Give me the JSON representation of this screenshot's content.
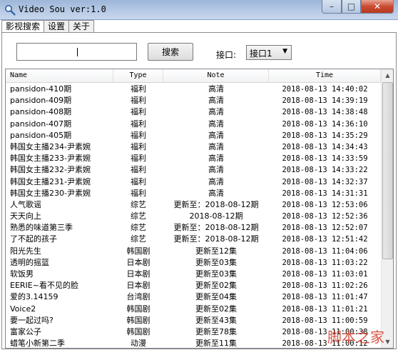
{
  "window": {
    "title": "Video Sou  ver:1.0",
    "minimize_glyph": "–",
    "maximize_glyph": "□",
    "close_glyph": "✕"
  },
  "tabs": [
    "影视搜索",
    "设置",
    "关于"
  ],
  "search": {
    "value": "",
    "button_label": "搜索"
  },
  "port": {
    "label": "接口:",
    "selected": "接口1"
  },
  "columns": {
    "name": "Name",
    "type": "Type",
    "note": "Note",
    "time": "Time"
  },
  "rows": [
    {
      "name": "pansidon-410期",
      "type": "福利",
      "note": "高清",
      "time": "2018-08-13 14:40:02"
    },
    {
      "name": "pansidon-409期",
      "type": "福利",
      "note": "高清",
      "time": "2018-08-13 14:39:19"
    },
    {
      "name": "pansidon-408期",
      "type": "福利",
      "note": "高清",
      "time": "2018-08-13 14:38:48"
    },
    {
      "name": "pansidon-407期",
      "type": "福利",
      "note": "高清",
      "time": "2018-08-13 14:36:10"
    },
    {
      "name": "pansidon-405期",
      "type": "福利",
      "note": "高清",
      "time": "2018-08-13 14:35:29"
    },
    {
      "name": "韩国女主播234-尹素婉",
      "type": "福利",
      "note": "高清",
      "time": "2018-08-13 14:34:43"
    },
    {
      "name": "韩国女主播233-尹素婉",
      "type": "福利",
      "note": "高清",
      "time": "2018-08-13 14:33:59"
    },
    {
      "name": "韩国女主播232-尹素婉",
      "type": "福利",
      "note": "高清",
      "time": "2018-08-13 14:33:22"
    },
    {
      "name": "韩国女主播231-尹素婉",
      "type": "福利",
      "note": "高清",
      "time": "2018-08-13 14:32:37"
    },
    {
      "name": "韩国女主播230-尹素婉",
      "type": "福利",
      "note": "高清",
      "time": "2018-08-13 14:31:31"
    },
    {
      "name": "人气歌谣",
      "type": "综艺",
      "note": "更新至：2018-08-12期",
      "time": "2018-08-13 12:53:06"
    },
    {
      "name": "天天向上",
      "type": "综艺",
      "note": "2018-08-12期",
      "time": "2018-08-13 12:52:36"
    },
    {
      "name": "熟悉的味道第三季",
      "type": "综艺",
      "note": "更新至：2018-08-12期",
      "time": "2018-08-13 12:52:07"
    },
    {
      "name": "了不起的孩子",
      "type": "综艺",
      "note": "更新至：2018-08-12期",
      "time": "2018-08-13 12:51:42"
    },
    {
      "name": "阳光先生",
      "type": "韩国剧",
      "note": "更新至12集",
      "time": "2018-08-13 11:04:06"
    },
    {
      "name": "透明的摇篮",
      "type": "日本剧",
      "note": "更新至03集",
      "time": "2018-08-13 11:03:22"
    },
    {
      "name": "软饭男",
      "type": "日本剧",
      "note": "更新至03集",
      "time": "2018-08-13 11:03:01"
    },
    {
      "name": "EERIE~看不见的脸",
      "type": "日本剧",
      "note": "更新至02集",
      "time": "2018-08-13 11:02:26"
    },
    {
      "name": "爱的3.14159",
      "type": "台湾剧",
      "note": "更新至04集",
      "time": "2018-08-13 11:01:47"
    },
    {
      "name": "Voice2",
      "type": "韩国剧",
      "note": "更新至02集",
      "time": "2018-08-13 11:01:21"
    },
    {
      "name": "要一起过吗?",
      "type": "韩国剧",
      "note": "更新至43集",
      "time": "2018-08-13 11:00:59"
    },
    {
      "name": "富家公子",
      "type": "韩国剧",
      "note": "更新至78集",
      "time": "2018-08-13 11:00:38"
    },
    {
      "name": "蜡笔小新第二季",
      "type": "动漫",
      "note": "更新至11集",
      "time": "2018-08-13 11:00:12"
    }
  ],
  "watermark": "脚本之家"
}
